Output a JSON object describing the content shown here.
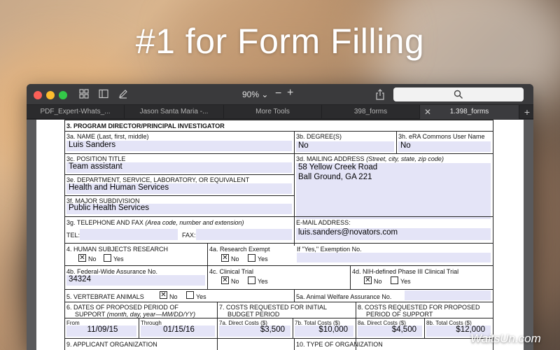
{
  "hero": {
    "title": "#1 for Form Filling"
  },
  "watermark": "WaitsUn.com",
  "toolbar": {
    "zoom": "90%"
  },
  "tabs": [
    {
      "label": "PDF_Expert-Whats_..."
    },
    {
      "label": "Jason Santa Maria -..."
    },
    {
      "label": "More Tools"
    },
    {
      "label": "398_forms"
    },
    {
      "label": "1.398_forms"
    }
  ],
  "form": {
    "s3": "3. PROGRAM DIRECTOR/PRINCIPAL INVESTIGATOR",
    "s3a": "3a. NAME  (Last, first, middle)",
    "s3a_val": "Luis Sanders",
    "s3b": "3b. DEGREE(S)",
    "s3b_val": "No",
    "s3h": "3h.  eRA Commons User Name",
    "s3h_val": "No",
    "s3c": "3c. POSITION TITLE",
    "s3c_val": "Team assistant",
    "s3d": "3d. MAILING ADDRESS",
    "s3d_hint": "(Street, city, state, zip code)",
    "s3d_line1": "58 Yellow Creek Road",
    "s3d_line2": "Ball Ground, GA 221",
    "s3e": "3e. DEPARTMENT, SERVICE, LABORATORY, OR EQUIVALENT",
    "s3e_val": "Health and Human Services",
    "s3f": "3f.  MAJOR SUBDIVISION",
    "s3f_val": "Public Health Services",
    "s3g": "3g. TELEPHONE AND FAX",
    "s3g_hint": "(Area code, number and extension)",
    "tel": "TEL:",
    "fax": "FAX:",
    "email_lbl": "E-MAIL ADDRESS:",
    "email_val": "luis.sanders@novators.com",
    "s4": "4.   HUMAN SUBJECTS RESEARCH",
    "no": "No",
    "yes": "Yes",
    "s4a": "4a. Research Exempt",
    "s4a_if": "If \"Yes,\" Exemption No.",
    "s4b": "4b. Federal-Wide Assurance No.",
    "s4b_val": "34324",
    "s4c": "4c. Clinical Trial",
    "s4d": "4d. NIH-defined Phase III Clinical Trial",
    "s5": "5.  VERTEBRATE  ANIMALS",
    "s5a": "5a. Animal Welfare Assurance No.",
    "s6_line1": "6.  DATES OF PROPOSED PERIOD OF",
    "s6_line2": "SUPPORT",
    "s6_hint": "(month, day, year—MM/DD/YY)",
    "s7_line1": "7.  COSTS REQUESTED FOR INITIAL",
    "s7_line2": "BUDGET PERIOD",
    "s8_line1": "8.  COSTS REQUESTED FOR PROPOSED",
    "s8_line2": "PERIOD OF SUPPORT",
    "from": "From",
    "through": "Through",
    "from_val": "11/09/15",
    "through_val": "01/15/16",
    "s7a": "7a. Direct Costs ($)",
    "s7a_val": "$3,500",
    "s7b": "7b.  Total Costs ($)",
    "s7b_val": "$10,000",
    "s8a": "8a.  Direct Costs ($)",
    "s8a_val": "$4,500",
    "s8b": "8b.  Total Costs ($)",
    "s8b_val": "$12,000",
    "s9": "9.  APPLICANT ORGANIZATION",
    "s10": "10. TYPE OF ORGANIZATION"
  }
}
